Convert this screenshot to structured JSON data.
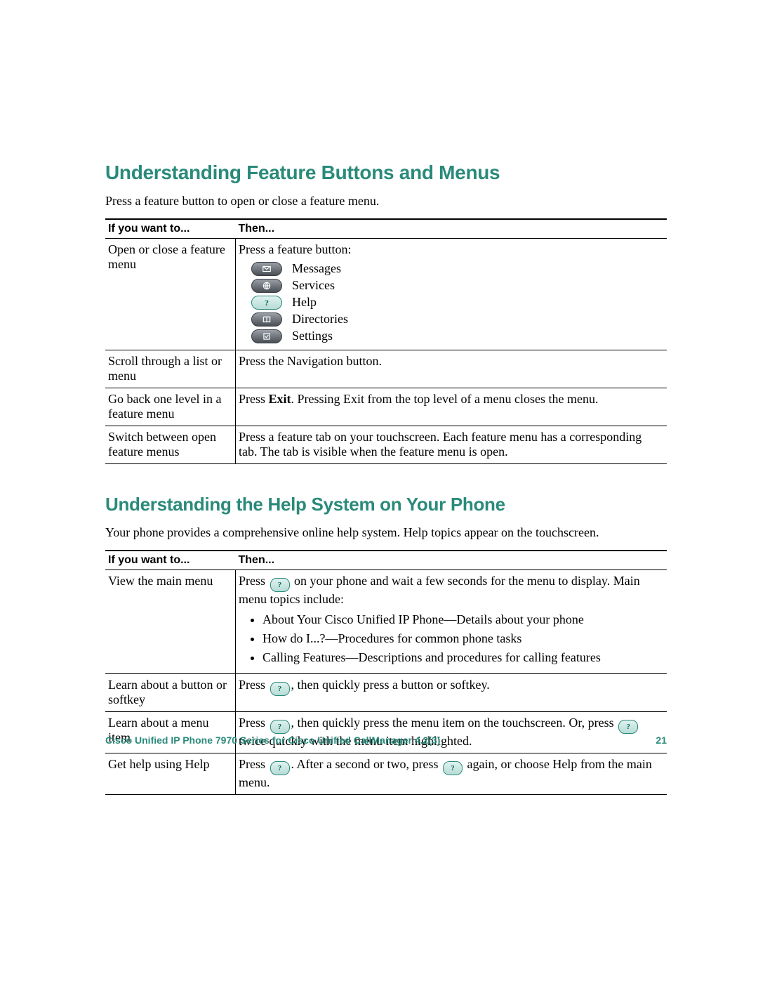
{
  "section1": {
    "heading": "Understanding Feature Buttons and Menus",
    "intro": "Press a feature button to open or close a feature menu.",
    "col1": "If you want to...",
    "col2": "Then...",
    "row1": {
      "want": "Open or close a feature menu",
      "lead": "Press a feature button:",
      "buttons": {
        "messages": "Messages",
        "services": "Services",
        "help": "Help",
        "directories": "Directories",
        "settings": "Settings"
      }
    },
    "row2": {
      "want": "Scroll through a list or menu",
      "then": "Press the Navigation button."
    },
    "row3": {
      "want": "Go back one level in a feature menu",
      "then_a": "Press ",
      "then_b": "Exit",
      "then_c": ". Pressing Exit from the top level of a menu closes the menu."
    },
    "row4": {
      "want": "Switch between open feature menus",
      "then": "Press a feature tab on your touchscreen. Each feature menu has a corresponding tab. The tab is visible when the feature menu is open."
    }
  },
  "section2": {
    "heading": "Understanding the Help System on Your Phone",
    "intro": "Your phone provides a comprehensive online help system. Help topics appear on the touchscreen.",
    "col1": "If you want to...",
    "col2": "Then...",
    "row1": {
      "want": "View the main menu",
      "a": "Press ",
      "b": " on your phone and wait a few seconds for the menu to display. Main menu topics include:",
      "topics": {
        "t1": "About Your Cisco Unified IP Phone—Details about your phone",
        "t2": "How do I...?—Procedures for common phone tasks",
        "t3": "Calling Features—Descriptions and procedures for calling features"
      }
    },
    "row2": {
      "want": "Learn about a button or softkey",
      "a": "Press ",
      "b": ", then quickly press a button or softkey."
    },
    "row3": {
      "want": "Learn about a menu item",
      "a": "Press ",
      "b": ", then quickly press the menu item on the touchscreen. Or, press ",
      "c": " twice quickly with the menu item highlighted."
    },
    "row4": {
      "want": "Get help using Help",
      "a": "Press ",
      "b": ". After a second or two, press ",
      "c": " again, or choose Help from the main menu."
    }
  },
  "footer": {
    "title": "Cisco Unified IP Phone 7970 Series for Cisco Unified CallManager 4.2(3)",
    "page": "21"
  },
  "icons": {
    "help_glyph": "?"
  }
}
